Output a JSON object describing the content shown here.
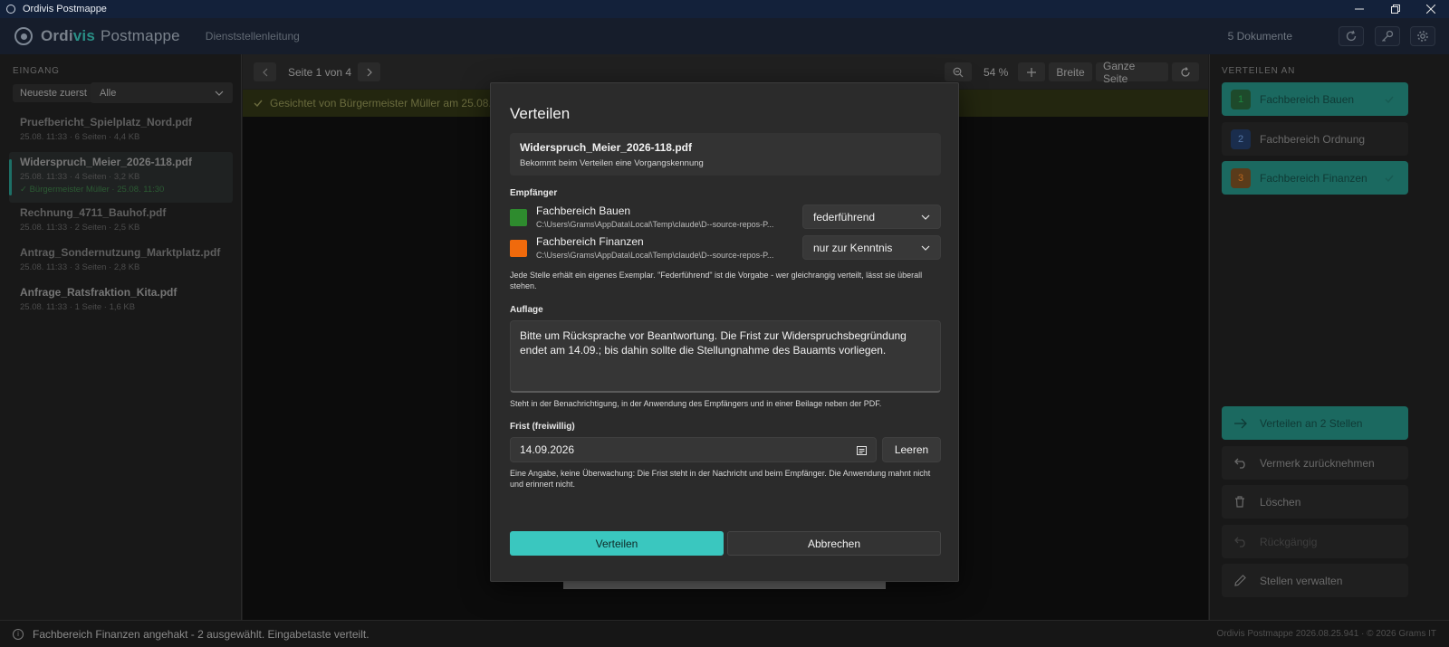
{
  "window": {
    "title": "Ordivis Postmappe",
    "controls": {
      "minimize_icon": "minimize-icon",
      "restore_icon": "restore-icon",
      "close_icon": "close-icon"
    }
  },
  "header": {
    "brand_part1": "Ordi",
    "brand_part2": "vis",
    "brand_part3": "Postmappe",
    "role": "Dienststellenleitung",
    "doc_count": "5 Dokumente",
    "buttons": [
      "refresh-icon",
      "key-icon",
      "gear-icon"
    ]
  },
  "sidebar": {
    "section_label": "EINGANG",
    "sort_label": "Neueste zuerst",
    "filter_value": "Alle",
    "files": [
      {
        "name": "Pruefbericht_Spielplatz_Nord.pdf",
        "meta": "25.08. 11:33  ·  6 Seiten  ·  4,4 KB"
      },
      {
        "name": "Widerspruch_Meier_2026-118.pdf",
        "meta": "25.08. 11:33  ·  4 Seiten  ·  3,2 KB",
        "status": "✓ Bürgermeister Müller · 25.08. 11:30"
      },
      {
        "name": "Rechnung_4711_Bauhof.pdf",
        "meta": "25.08. 11:33  ·  2 Seiten  ·  2,5 KB"
      },
      {
        "name": "Antrag_Sondernutzung_Marktplatz.pdf",
        "meta": "25.08. 11:33  ·  3 Seiten  ·  2,8 KB"
      },
      {
        "name": "Anfrage_Ratsfraktion_Kita.pdf",
        "meta": "25.08. 11:33  ·  1 Seite  ·  1,6 KB"
      }
    ]
  },
  "viewer": {
    "page_info": "Seite 1 von 4",
    "zoom": "54 %",
    "fit_width": "Breite",
    "fit_page": "Ganze Seite",
    "banner": "Gesichtet von Bürgermeister Müller am 25.08."
  },
  "right_panel": {
    "section_label": "VERTEILEN AN",
    "targets": [
      {
        "num": "1",
        "label": "Fachbereich Bauen",
        "checked": true,
        "color": "#2e7d32"
      },
      {
        "num": "2",
        "label": "Fachbereich Ordnung",
        "checked": false,
        "color": "#1f4fa0"
      },
      {
        "num": "3",
        "label": "Fachbereich Finanzen",
        "checked": true,
        "color": "#e8660c"
      }
    ],
    "actions": {
      "distribute": "Verteilen an 2 Stellen",
      "revoke": "Vermerk zurücknehmen",
      "delete": "Löschen",
      "undo": "Rückgängig",
      "manage": "Stellen verwalten"
    }
  },
  "status": {
    "message": "Fachbereich Finanzen angehakt - 2 ausgewählt. Eingabetaste verteilt.",
    "version": "Ordivis Postmappe 2026.08.25.941  ·  © 2026 Grams IT"
  },
  "dialog": {
    "title": "Verteilen",
    "file_name": "Widerspruch_Meier_2026-118.pdf",
    "file_sub": "Bekommt beim Verteilen eine Vorgangskennung",
    "recipients_label": "Empfänger",
    "recipients": [
      {
        "name": "Fachbereich Bauen",
        "path": "C:\\Users\\Grams\\AppData\\Local\\Temp\\claude\\D--source-repos-P...",
        "role": "federführend",
        "color": "#2e8b2e"
      },
      {
        "name": "Fachbereich Finanzen",
        "path": "C:\\Users\\Grams\\AppData\\Local\\Temp\\claude\\D--source-repos-P...",
        "role": "nur zur Kenntnis",
        "color": "#f06a0c"
      }
    ],
    "recipients_hint": "Jede Stelle erhält ein eigenes Exemplar. \"Federführend\" ist die Vorgabe - wer gleichrangig verteilt, lässt sie überall stehen.",
    "auflage_label": "Auflage",
    "auflage_text": "Bitte um Rücksprache vor Beantwortung. Die Frist zur Widerspruchsbegründung endet am 14.09.; bis dahin sollte die Stellungnahme des Bauamts vorliegen.",
    "auflage_hint": "Steht in der Benachrichtigung, in der Anwendung des Empfängers und in einer Beilage neben der PDF.",
    "frist_label": "Frist (freiwillig)",
    "frist_value": "14.09.2026",
    "clear_label": "Leeren",
    "frist_hint": "Eine Angabe, keine Überwachung: Die Frist steht in der Nachricht und beim Empfänger. Die Anwendung mahnt nicht und erinnert nicht.",
    "ok_label": "Verteilen",
    "cancel_label": "Abbrechen"
  }
}
